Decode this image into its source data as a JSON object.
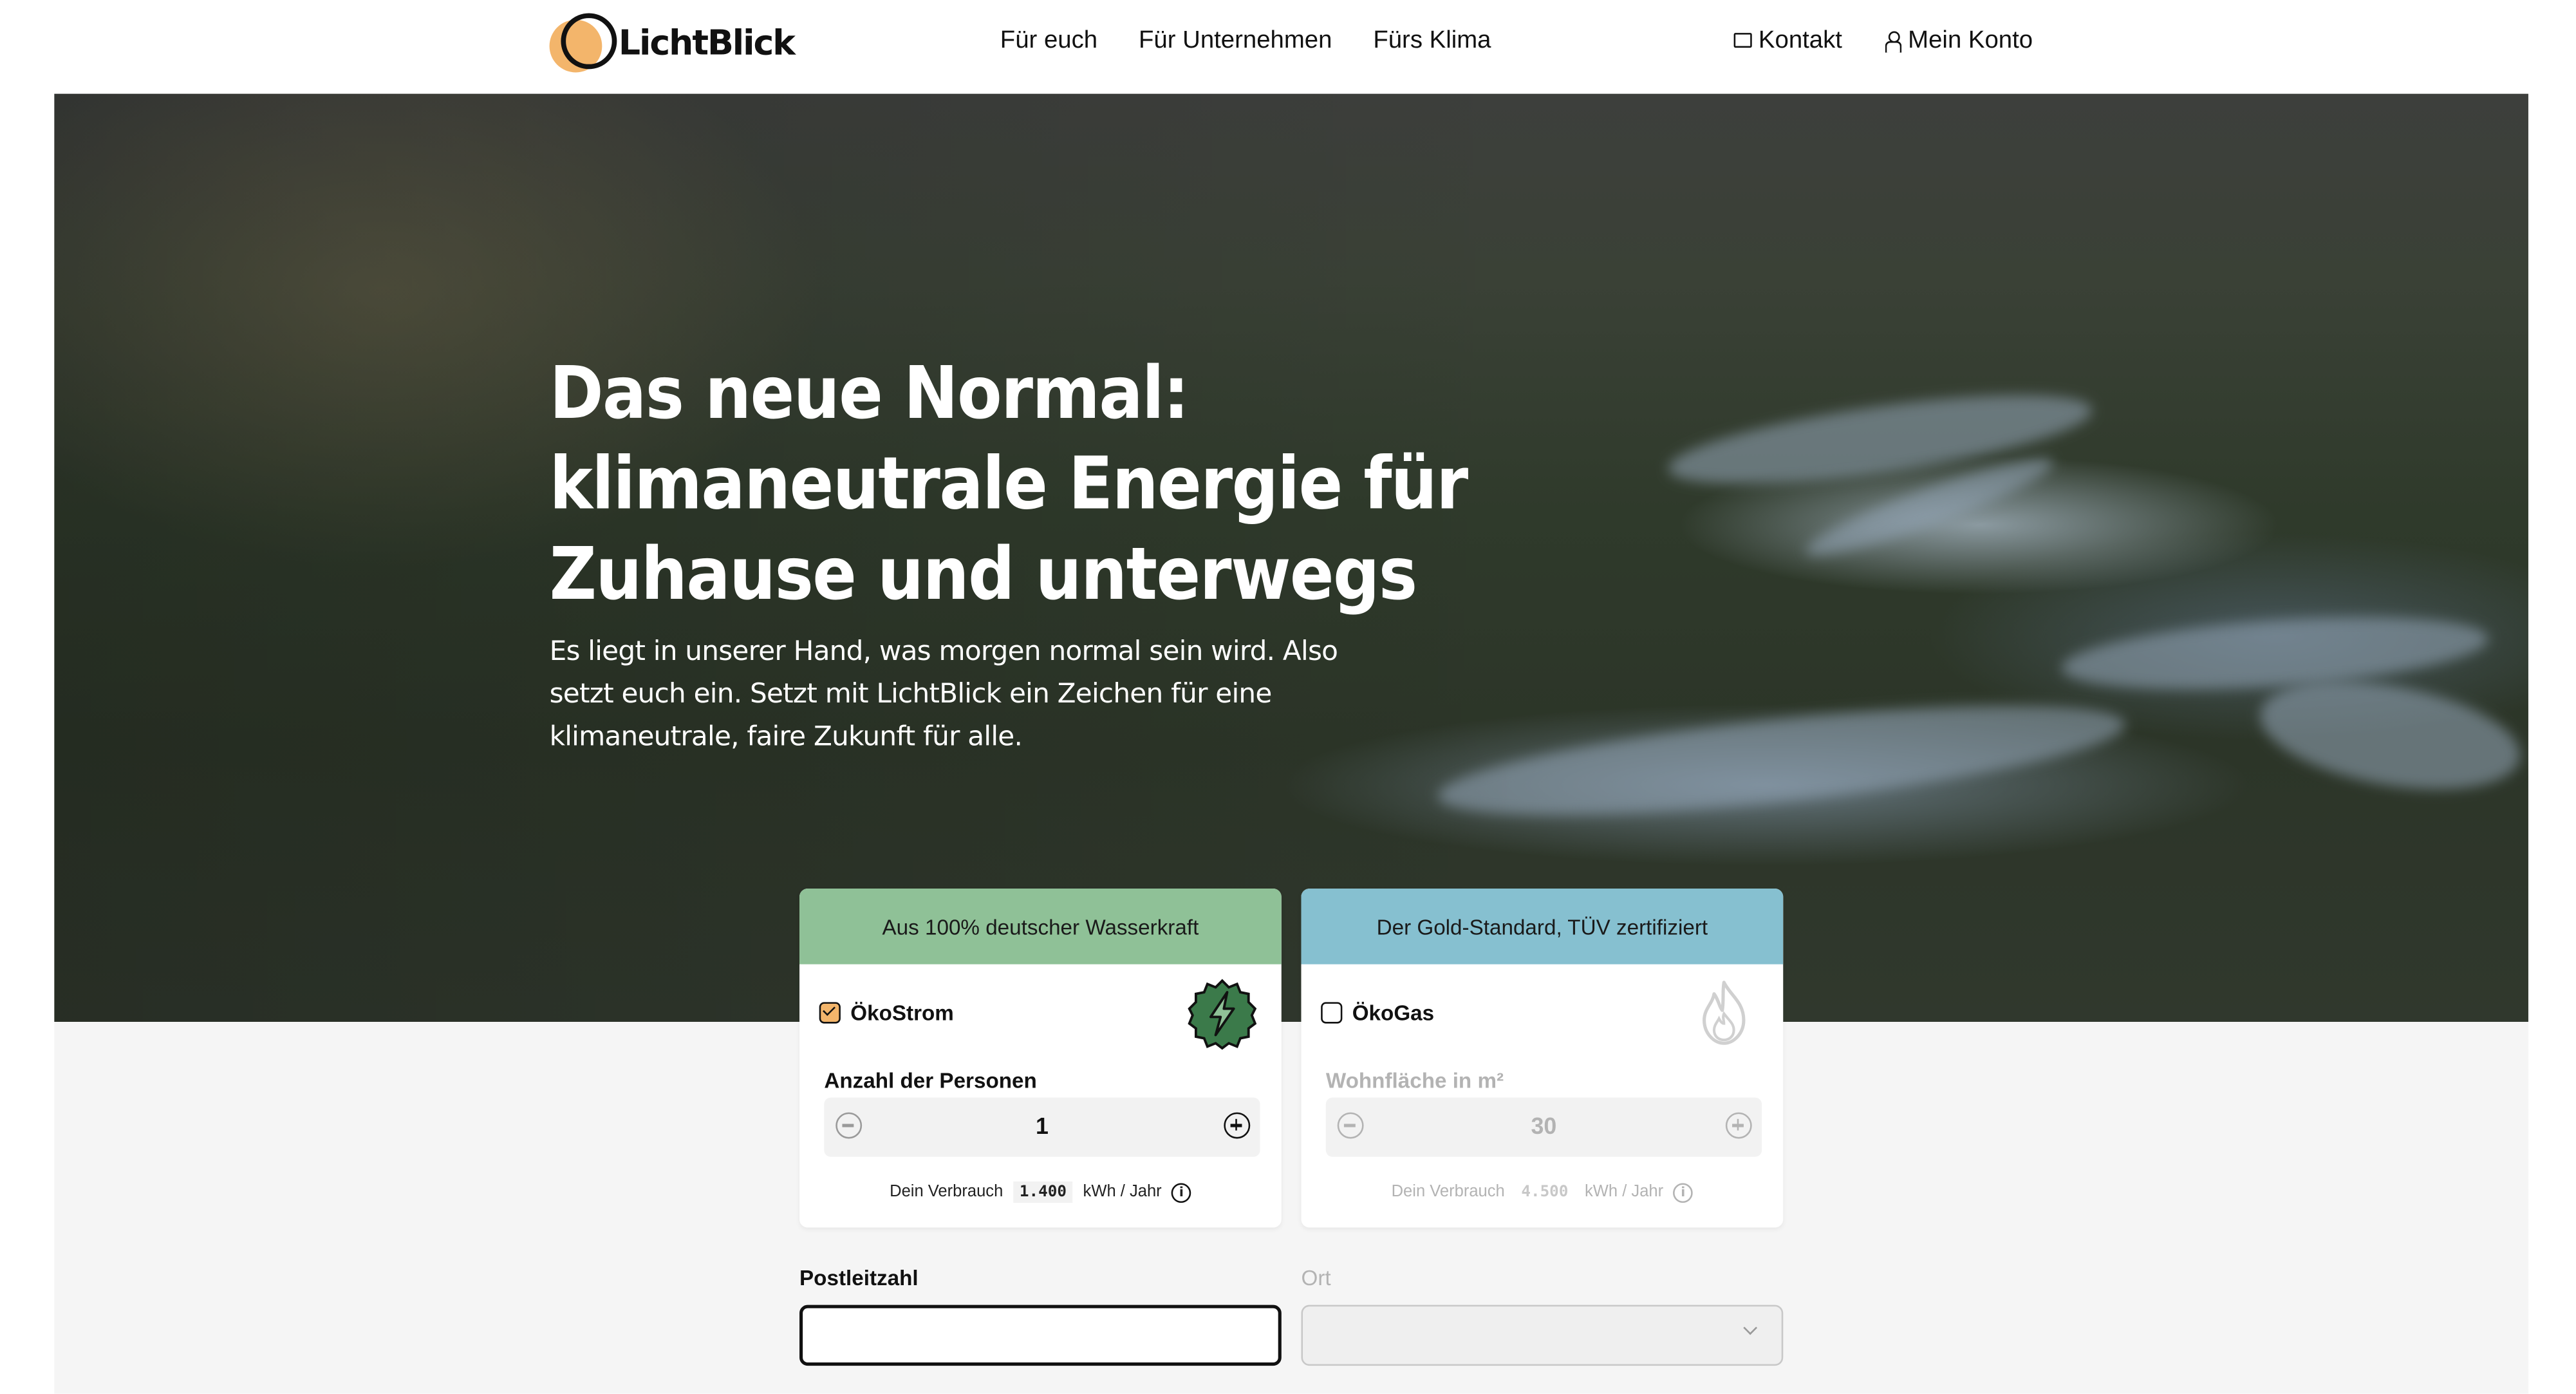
{
  "brand": {
    "name": "LichtBlick",
    "accent": "#f3b56b"
  },
  "nav": {
    "items": [
      "Für euch",
      "Für Unternehmen",
      "Fürs Klima"
    ]
  },
  "utility": {
    "contact": "Kontakt",
    "account": "Mein Konto"
  },
  "hero": {
    "headline": "Das neue Normal: klimaneutrale Energie für Zuhause und unterwegs",
    "subline": "Es liegt in unserer Hand, was morgen normal sein wird. Also setzt euch ein. Setzt mit LichtBlick ein Zeichen für eine klimaneutrale, faire Zukunft für alle."
  },
  "cards": {
    "strom": {
      "banner": "Aus 100% deutscher Wasserkraft",
      "banner_color": "#8fc197",
      "product": "ÖkoStrom",
      "checked": true,
      "field_label": "Anzahl der Personen",
      "value": "1",
      "usage_prefix": "Dein Verbrauch",
      "usage_value": "1.400",
      "usage_unit": "kWh / Jahr",
      "icon": "lightning-badge-icon"
    },
    "gas": {
      "banner": "Der Gold-Standard, TÜV zertifiziert",
      "banner_color": "#86c0d0",
      "product": "ÖkoGas",
      "checked": false,
      "field_label": "Wohnfläche in m²",
      "value": "30",
      "usage_prefix": "Dein Verbrauch",
      "usage_value": "4.500",
      "usage_unit": "kWh / Jahr",
      "icon": "flame-icon"
    }
  },
  "form": {
    "plz_label": "Postleitzahl",
    "plz_value": "",
    "ort_label": "Ort",
    "ort_value": ""
  }
}
